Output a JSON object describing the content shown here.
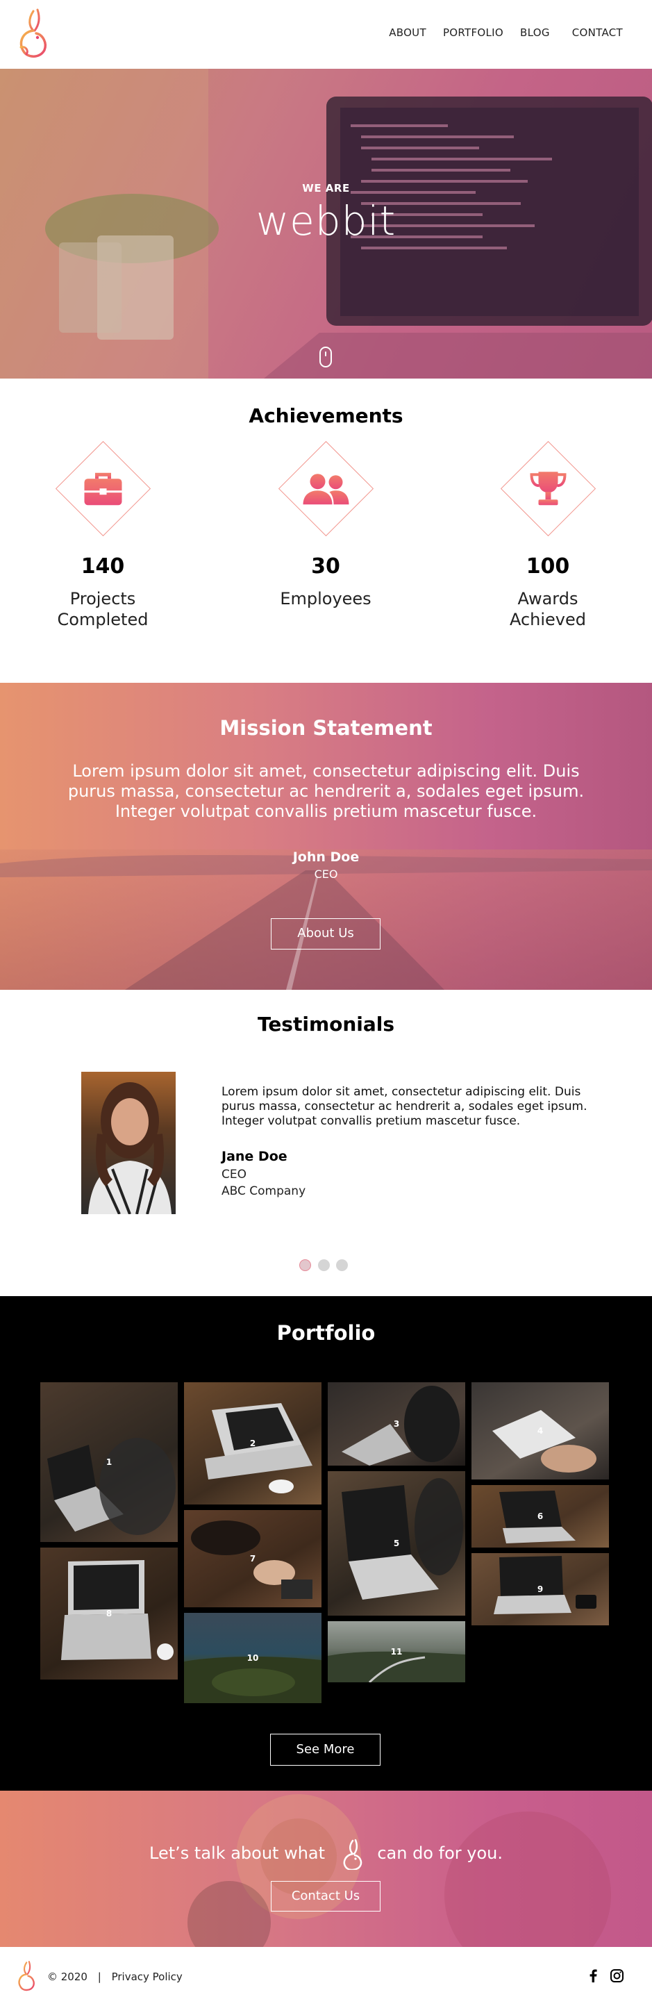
{
  "nav": {
    "items": [
      "ABOUT",
      "PORTFOLIO",
      "BLOG",
      "CONTACT"
    ]
  },
  "hero": {
    "kicker": "WE ARE",
    "title": "webbit"
  },
  "achievements": {
    "title": "Achievements",
    "items": [
      {
        "icon": "briefcase-icon",
        "value": "140",
        "label_line1": "Projects",
        "label_line2": "Completed"
      },
      {
        "icon": "people-icon",
        "value": "30",
        "label_line1": "Employees",
        "label_line2": ""
      },
      {
        "icon": "trophy-icon",
        "value": "100",
        "label_line1": "Awards",
        "label_line2": "Achieved"
      }
    ]
  },
  "mission": {
    "title": "Mission Statement",
    "quote": "Lorem ipsum dolor sit amet, consectetur adipiscing elit. Duis purus massa, consectetur ac hendrerit a, sodales eget ipsum. Integer volutpat convallis pretium mascetur fusce.",
    "name": "John Doe",
    "role": "CEO",
    "button": "About Us"
  },
  "testimonials": {
    "title": "Testimonials",
    "text": "Lorem ipsum dolor sit amet, consectetur adipiscing elit. Duis purus massa, consectetur ac hendrerit a, sodales eget ipsum. Integer volutpat convallis pretium mascetur fusce.",
    "name": "Jane Doe",
    "role": "CEO",
    "company": "ABC Company",
    "active_dot": 0
  },
  "portfolio": {
    "title": "Portfolio",
    "tiles": [
      "1",
      "2",
      "3",
      "4",
      "5",
      "6",
      "7",
      "8",
      "9",
      "10",
      "11"
    ],
    "button": "See More"
  },
  "cta": {
    "text_before": "Let’s talk about what",
    "text_after": "can do for you.",
    "button": "Contact Us"
  },
  "footer": {
    "copyright": "© 2020",
    "separator": "|",
    "privacy": "Privacy Policy",
    "social": [
      "facebook-icon",
      "instagram-icon"
    ]
  },
  "colors": {
    "accent": "#f05a78",
    "accent_light": "#f2968e",
    "dark": "#000000"
  }
}
